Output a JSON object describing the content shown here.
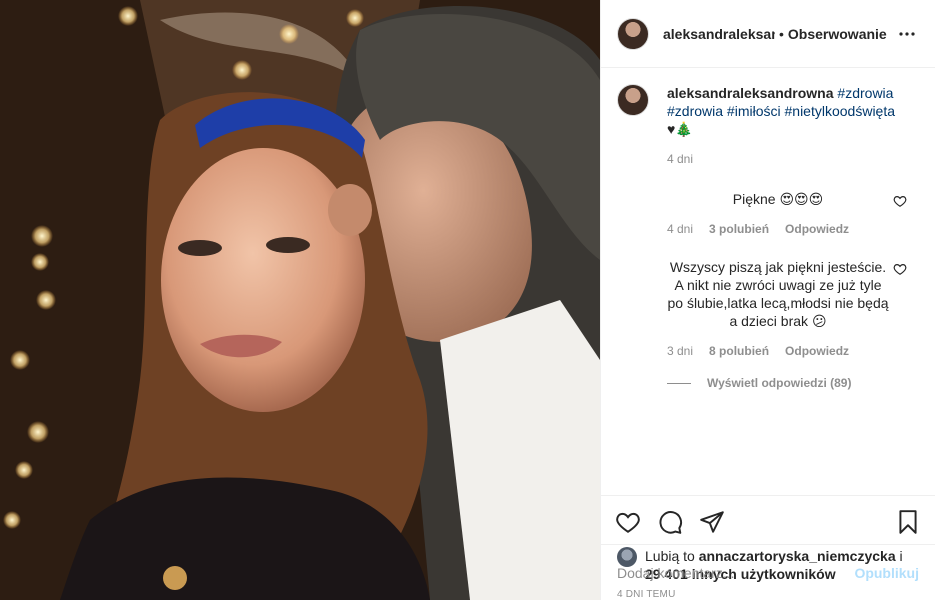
{
  "header": {
    "username": "aleksandraleksandrowna",
    "separator": "•",
    "follow_label": "Obserwowanie",
    "more_icon": "more-horizontal-icon"
  },
  "caption": {
    "username": "aleksandraleksandrowna",
    "tags": [
      "#zdrowia",
      "#zdrowia",
      "#imiłości",
      "#nietylkoodświęta"
    ],
    "emojis": "♥🎄",
    "age": "4 dni"
  },
  "comments": [
    {
      "text": "Piękne 😍😍😍",
      "age": "4 dni",
      "likes": "3 polubień",
      "reply": "Odpowiedz"
    },
    {
      "text": "Wszyscy piszą jak piękni jesteście. A nikt nie zwróci uwagi ze już tyle po ślubie,latka lecą,młodsi nie będą a dzieci brak",
      "emoji": "😕",
      "age": "3 dni",
      "likes": "8 polubień",
      "reply": "Odpowiedz"
    }
  ],
  "view_replies": "Wyświetl odpowiedzi (89)",
  "actions": {
    "like_icon": "heart-icon",
    "comment_icon": "comment-icon",
    "share_icon": "share-icon",
    "save_icon": "bookmark-icon"
  },
  "likes": {
    "prefix": "Lubią to",
    "user": "annaczartoryska_niemczycka",
    "and": "i",
    "others": "29 401 innych użytkowników"
  },
  "timestamp": "4 DNI TEMU",
  "add_comment": {
    "placeholder": "Dodaj komentarz...",
    "post_label": "Opublikuj"
  },
  "colors": {
    "hashtag": "#00376b",
    "muted": "#8e8e8e",
    "post_disabled": "#b2dffc",
    "border": "#efefef"
  }
}
